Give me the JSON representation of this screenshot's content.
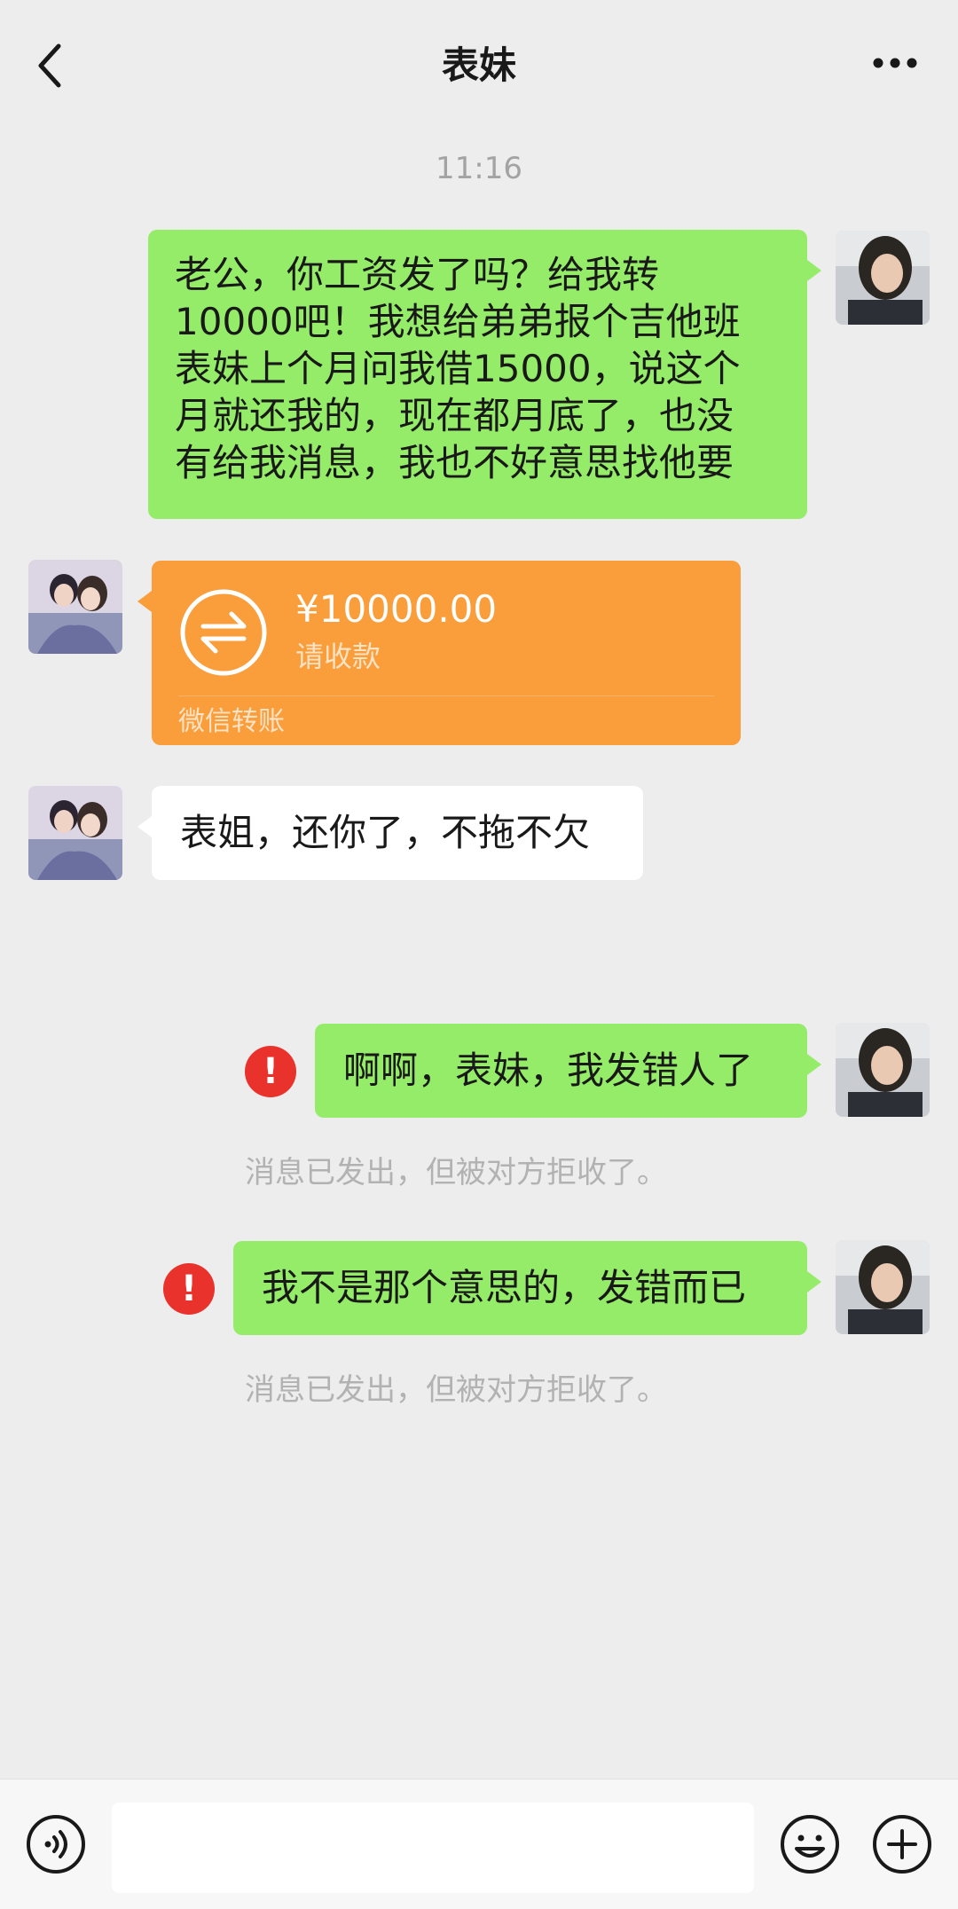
{
  "header": {
    "title": "表妹",
    "back_icon": "chevron-left-icon",
    "more_icon": "more-horizontal-icon"
  },
  "timestamp": "11:16",
  "messages": [
    {
      "sender": "me",
      "type": "text",
      "lines": [
        "老公，你工资发了吗？给我转",
        "10000吧！我想给弟弟报个吉他班",
        "表妹上个月问我借15000，说这个",
        "月就还我的，现在都月底了，也没",
        "有给我消息，我也不好意思找他要"
      ]
    },
    {
      "sender": "other",
      "type": "transfer",
      "amount": "¥10000.00",
      "status": "请收款",
      "footer": "微信转账",
      "icon": "transfer-arrows-icon"
    },
    {
      "sender": "other",
      "type": "text",
      "text": "表姐，还你了，不拖不欠"
    },
    {
      "sender": "me",
      "type": "text",
      "text": "啊啊，表妹，我发错人了",
      "failed": true,
      "system_note": "消息已发出，但被对方拒收了。"
    },
    {
      "sender": "me",
      "type": "text",
      "text": "我不是那个意思的，发错而已",
      "failed": true,
      "system_note": "消息已发出，但被对方拒收了。"
    }
  ],
  "input_bar": {
    "voice_icon": "voice-icon",
    "emoji_icon": "emoji-icon",
    "plus_icon": "plus-icon",
    "input_value": ""
  },
  "colors": {
    "background": "#ededed",
    "my_bubble": "#95ec69",
    "other_bubble": "#ffffff",
    "transfer": "#fa9d3b",
    "error": "#e9322c"
  }
}
